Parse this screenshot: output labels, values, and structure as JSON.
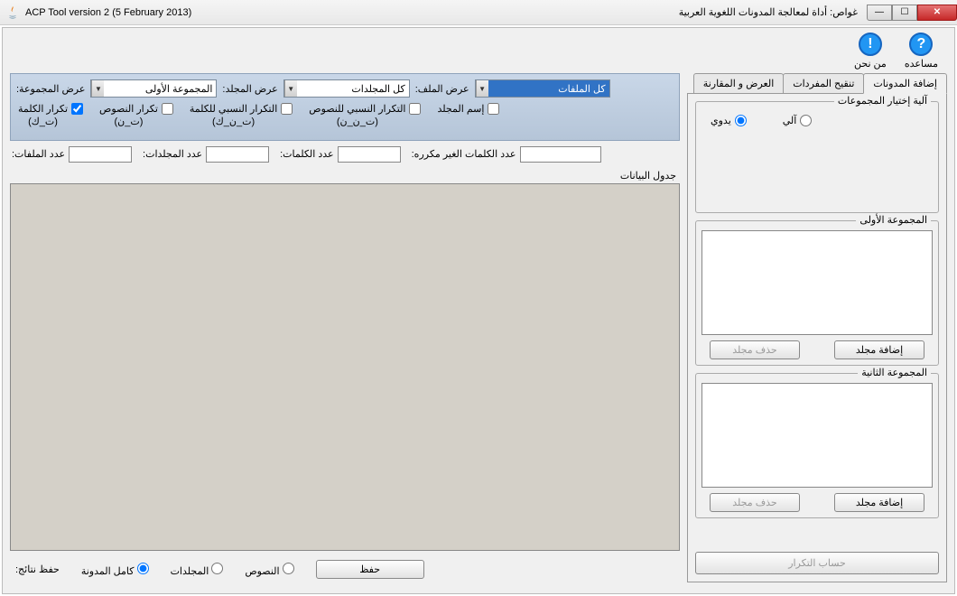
{
  "window": {
    "title_left": "ACP Tool version 2 (5 February 2013)",
    "title_right": "غواص: أداة لمعالجة المدونات اللغوية العربية"
  },
  "toolbar": {
    "about": "من نحن",
    "help": "مساعده"
  },
  "tabs": {
    "add_corpora": "إضافة المدونات",
    "refine_vocab": "تنقيح المفردات",
    "view_compare": "العرض و المقارنة"
  },
  "right": {
    "group_select_legend": "آلية إختيار المجموعات",
    "manual": "يدوي",
    "auto": "آلي",
    "group1_legend": "المجموعة الأولى",
    "group2_legend": "المجموعة الثانية",
    "add_folder": "إضافة مجلد",
    "delete_folder": "حذف مجلد",
    "compute_repetition": "حساب التكرار"
  },
  "dropdowns": {
    "group_view_lbl": "عرض المجموعة:",
    "group_view_val": "المجموعة الأولى",
    "folder_view_lbl": "عرض المجلد:",
    "folder_view_val": "كل المجلدات",
    "file_view_lbl": "عرض الملف:",
    "file_view_val": "كل الملفات"
  },
  "checks": {
    "word_rep": "تكرار الكلمة\n(ت_ك)",
    "text_rep": "تكرار النصوص\n(ت_ن)",
    "word_rel": "التكرار النسبي للكلمة\n(ت_ن_ك)",
    "text_rel": "التكرار النسبي للنصوص\n(ت_ن_ن)",
    "folder_name": "إسم المجلد"
  },
  "stats": {
    "files": "عدد الملفات:",
    "folders": "عدد المجلدات:",
    "words": "عدد الكلمات:",
    "unique_words": "عدد الكلمات الغير مكرره:"
  },
  "table_label": "جدول البيانات",
  "bottom": {
    "save_results": "حفظ نتائج:",
    "whole_corpus": "كامل المدونة",
    "folders": "المجلدات",
    "texts": "النصوص",
    "save": "حفظ"
  }
}
